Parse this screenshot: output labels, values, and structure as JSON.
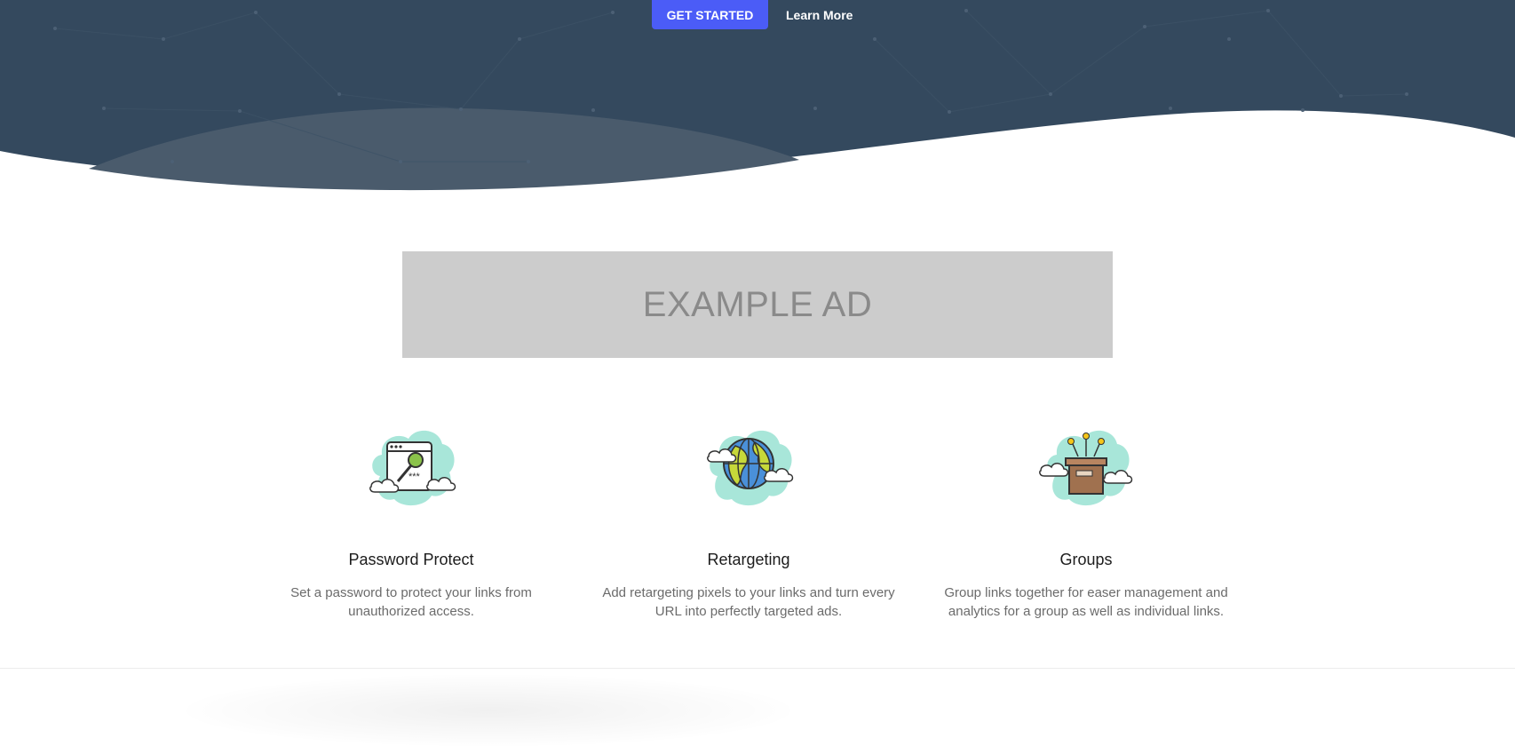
{
  "hero": {
    "cta_primary": "GET STARTED",
    "cta_secondary": "Learn More",
    "background_color": "#34495e",
    "wave_color": "#4a5b6c",
    "button_color": "#4b5cf7"
  },
  "ad": {
    "label": "EXAMPLE AD"
  },
  "features": [
    {
      "icon": "password-key-icon",
      "title": "Password Protect",
      "description": "Set a password to protect your links from unauthorized access."
    },
    {
      "icon": "globe-icon",
      "title": "Retargeting",
      "description": "Add retargeting pixels to your links and turn every URL into perfectly targeted ads."
    },
    {
      "icon": "box-group-icon",
      "title": "Groups",
      "description": "Group links together for easer management and analytics for a group as well as individual links."
    }
  ]
}
